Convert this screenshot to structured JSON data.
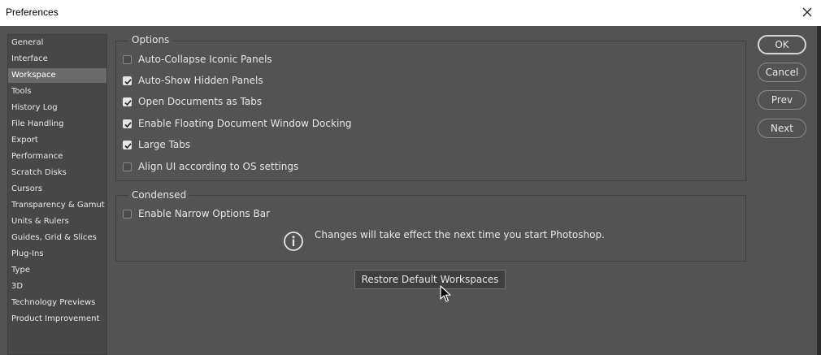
{
  "window": {
    "title": "Preferences"
  },
  "sidebar": {
    "items": [
      {
        "label": "General"
      },
      {
        "label": "Interface"
      },
      {
        "label": "Workspace",
        "selected": true
      },
      {
        "label": "Tools"
      },
      {
        "label": "History Log"
      },
      {
        "label": "File Handling"
      },
      {
        "label": "Export"
      },
      {
        "label": "Performance"
      },
      {
        "label": "Scratch Disks"
      },
      {
        "label": "Cursors"
      },
      {
        "label": "Transparency & Gamut"
      },
      {
        "label": "Units & Rulers"
      },
      {
        "label": "Guides, Grid & Slices"
      },
      {
        "label": "Plug-Ins"
      },
      {
        "label": "Type"
      },
      {
        "label": "3D"
      },
      {
        "label": "Technology Previews"
      },
      {
        "label": "Product Improvement"
      }
    ]
  },
  "options": {
    "legend": "Options",
    "checkboxes": [
      {
        "label": "Auto-Collapse Iconic Panels",
        "checked": false
      },
      {
        "label": "Auto-Show Hidden Panels",
        "checked": true
      },
      {
        "label": "Open Documents as Tabs",
        "checked": true
      },
      {
        "label": "Enable Floating Document Window Docking",
        "checked": true
      },
      {
        "label": "Large Tabs",
        "checked": true
      },
      {
        "label": "Align UI according to OS settings",
        "checked": false
      }
    ]
  },
  "condensed": {
    "legend": "Condensed",
    "checkboxes": [
      {
        "label": "Enable Narrow Options Bar",
        "checked": false
      }
    ],
    "info_text": "Changes will take effect the next time you start Photoshop."
  },
  "actions": {
    "restore_label": "Restore Default Workspaces",
    "ok_label": "OK",
    "cancel_label": "Cancel",
    "prev_label": "Prev",
    "next_label": "Next"
  },
  "icons": {
    "close": "close-icon",
    "info": "info-icon",
    "check": "check-icon",
    "cursor": "mouse-cursor-icon"
  },
  "colors": {
    "dialog_bg": "#535353",
    "sidebar_bg": "#474747",
    "selected_bg": "#6a6a6a",
    "text": "#e6e6e6"
  }
}
